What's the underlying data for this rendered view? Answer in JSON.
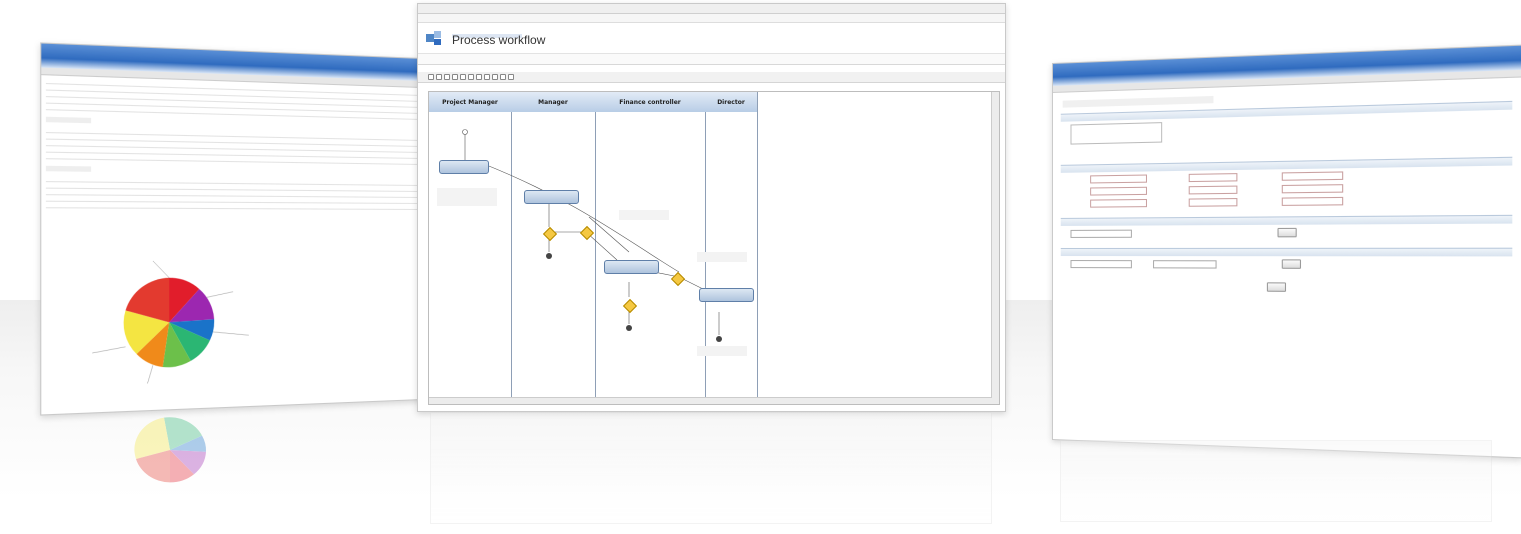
{
  "center": {
    "page_title": "Process workflow",
    "lanes": [
      "Project Manager",
      "Manager",
      "Finance controller",
      "Director"
    ]
  },
  "colors": {
    "accent_blue": "#2f6bbf",
    "lane_header": "#b8cde6",
    "decision_diamond": "#f5c842",
    "pie_slices": [
      "#e11d2b",
      "#9c27b0",
      "#1a73c9",
      "#2bb673",
      "#6cc04a",
      "#f08a1a",
      "#f4e542"
    ]
  },
  "icons": {
    "logo": "app-logo-icon",
    "start": "start-node-icon",
    "end": "end-node-icon"
  }
}
